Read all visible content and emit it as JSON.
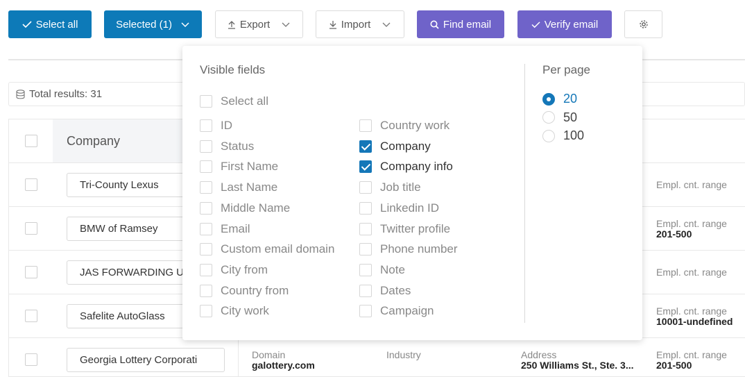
{
  "toolbar": {
    "select_all": "Select all",
    "selected": "Selected (1)",
    "export": "Export",
    "import": "Import",
    "find_email": "Find email",
    "verify_email": "Verify email"
  },
  "total_results": "Total results: 31",
  "table": {
    "header_company": "Company",
    "rows": [
      {
        "company": "Tri-County Lexus",
        "empl_label": "Empl. cnt. range",
        "empl_value": ""
      },
      {
        "company": "BMW of Ramsey",
        "empl_label": "Empl. cnt. range",
        "empl_value": "201-500"
      },
      {
        "company": "JAS FORWARDING USA",
        "empl_label": "Empl. cnt. range",
        "empl_value": ""
      },
      {
        "company": "Safelite AutoGlass",
        "empl_label": "Empl. cnt. range",
        "empl_value": "10001-undefined"
      },
      {
        "company": "Georgia Lottery Corporati",
        "empl_label": "Empl. cnt. range",
        "empl_value": "201-500",
        "domain_label": "Domain",
        "domain_value": "galottery.com",
        "industry_label": "Industry",
        "address_label": "Address",
        "address_value": "250 Williams St., Ste. 3..."
      }
    ]
  },
  "visible_fields": {
    "title": "Visible fields",
    "select_all": "Select all",
    "col1": [
      {
        "label": "ID",
        "checked": false
      },
      {
        "label": "Status",
        "checked": false
      },
      {
        "label": "First Name",
        "checked": false
      },
      {
        "label": "Last Name",
        "checked": false
      },
      {
        "label": "Middle Name",
        "checked": false
      },
      {
        "label": "Email",
        "checked": false
      },
      {
        "label": "Custom email domain",
        "checked": false
      },
      {
        "label": "City from",
        "checked": false
      },
      {
        "label": "Country from",
        "checked": false
      },
      {
        "label": "City work",
        "checked": false
      }
    ],
    "col2": [
      {
        "label": "Country work",
        "checked": false
      },
      {
        "label": "Company",
        "checked": true
      },
      {
        "label": "Company info",
        "checked": true
      },
      {
        "label": "Job title",
        "checked": false
      },
      {
        "label": "Linkedin ID",
        "checked": false
      },
      {
        "label": "Twitter profile",
        "checked": false
      },
      {
        "label": "Phone number",
        "checked": false
      },
      {
        "label": "Note",
        "checked": false
      },
      {
        "label": "Dates",
        "checked": false
      },
      {
        "label": "Campaign",
        "checked": false
      }
    ]
  },
  "per_page": {
    "title": "Per page",
    "options": [
      "20",
      "50",
      "100"
    ],
    "selected": "20"
  },
  "colors": {
    "primary": "#0d7ab8",
    "purple": "#6f63c9"
  },
  "icons": [
    "check-icon",
    "chevron-down-icon",
    "upload-icon",
    "download-icon",
    "search-icon",
    "gear-icon",
    "database-icon"
  ]
}
